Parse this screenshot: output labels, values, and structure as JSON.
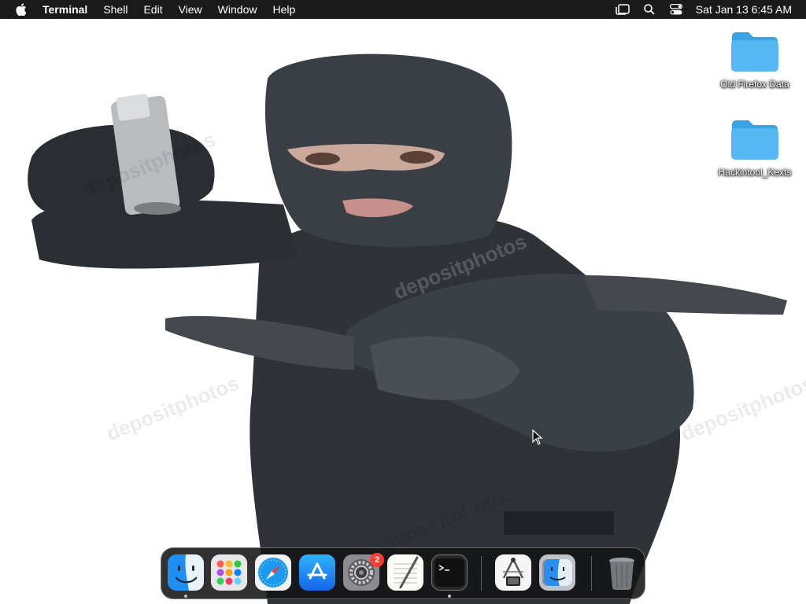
{
  "menubar": {
    "apple": "apple-logo-icon",
    "app_name": "Terminal",
    "menus": [
      "Shell",
      "Edit",
      "View",
      "Window",
      "Help"
    ],
    "status_icons": [
      "stage-manager-icon",
      "search-icon",
      "control-center-icon"
    ],
    "clock": "Sat Jan 13  6:45 AM"
  },
  "wallpaper": {
    "description_icon": "masked-figure-wallpaper",
    "watermark_text": "depositphotos"
  },
  "desktop": {
    "icons": [
      {
        "label": "Old Firefox Data",
        "icon": "folder-icon"
      },
      {
        "label": "Hackintool_Kexts",
        "icon": "folder-icon"
      }
    ]
  },
  "dock": {
    "apps": [
      {
        "name": "Finder",
        "icon": "finder-icon",
        "running": true
      },
      {
        "name": "Launchpad",
        "icon": "launchpad-icon",
        "running": false
      },
      {
        "name": "Safari",
        "icon": "safari-icon",
        "running": false
      },
      {
        "name": "App Store",
        "icon": "app-store-icon",
        "running": false
      },
      {
        "name": "System Settings",
        "icon": "system-settings-icon",
        "running": false,
        "badge": "2"
      },
      {
        "name": "TextEdit",
        "icon": "textedit-icon",
        "running": false
      },
      {
        "name": "Terminal",
        "icon": "terminal-icon",
        "running": true
      },
      {
        "name": "System Information",
        "icon": "system-information-icon",
        "running": false
      },
      {
        "name": "Migration Assistant",
        "icon": "migration-assistant-icon",
        "running": false
      },
      {
        "name": "Trash",
        "icon": "trash-icon",
        "running": false
      }
    ]
  },
  "colors": {
    "menubar_bg": "#1a1a1a",
    "folder_blue": "#4fb3f0",
    "badge_red": "#ff3b30"
  }
}
